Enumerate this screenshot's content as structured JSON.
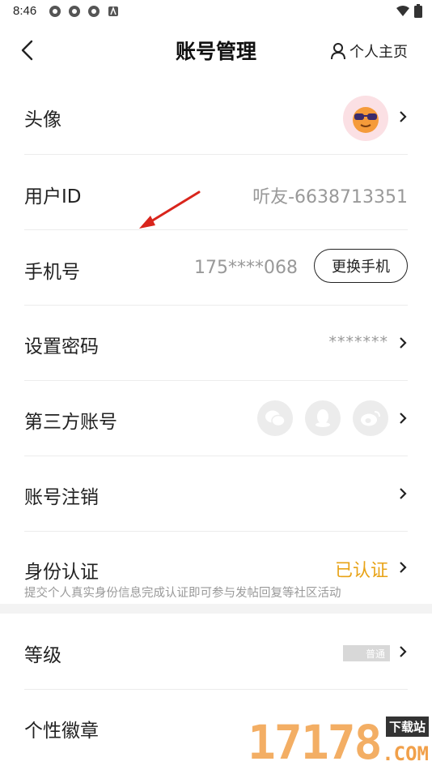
{
  "status_bar": {
    "time": "8:46"
  },
  "header": {
    "title": "账号管理",
    "profile_label": "个人主页"
  },
  "rows": {
    "avatar": {
      "label": "头像"
    },
    "user_id": {
      "label": "用户ID",
      "value": "听友-6638713351"
    },
    "phone": {
      "label": "手机号",
      "value": "175****068",
      "button": "更换手机"
    },
    "password": {
      "label": "设置密码",
      "value": "*******"
    },
    "third_party": {
      "label": "第三方账号",
      "icons": [
        "wechat-icon",
        "qq-icon",
        "weibo-icon"
      ]
    },
    "cancel": {
      "label": "账号注销"
    },
    "identity": {
      "label": "身份认证",
      "value": "已认证",
      "note": "提交个人真实身份信息完成认证即可参与发帖回复等社区活动"
    },
    "level": {
      "label": "等级",
      "value": "普通"
    },
    "medal": {
      "label": "个性徽章"
    }
  },
  "watermark": {
    "text": "17178",
    "sub": "下载站",
    "domain": ".COM"
  },
  "colors": {
    "verified": "#e8a317",
    "muted": "#999999",
    "arrow": "#d9251c"
  }
}
